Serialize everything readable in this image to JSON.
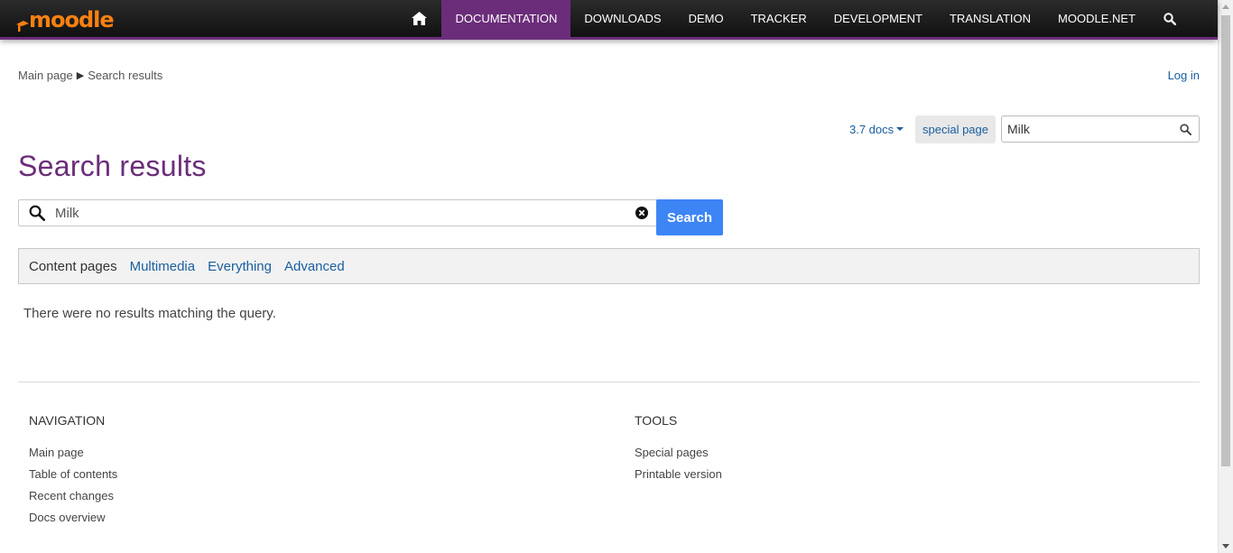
{
  "header": {
    "logo_text": "moodle",
    "nav": [
      "Documentation",
      "Downloads",
      "Demo",
      "Tracker",
      "Development",
      "Translation",
      "moodle.net"
    ],
    "active_index": 0,
    "home_icon": "home-icon",
    "search_icon": "search-icon",
    "accent_color": "#6b2d7a",
    "logo_color": "#f98012"
  },
  "breadcrumb": {
    "items": [
      "Main page",
      "Search results"
    ],
    "separator": "▶"
  },
  "login_label": "Log in",
  "tools": {
    "docs_version": "3.7 docs",
    "special_page": "special page",
    "search_value": "Milk"
  },
  "page_title": "Search results",
  "main_search": {
    "value": "Milk",
    "button_label": "Search",
    "button_color": "#3d85f5"
  },
  "filters": {
    "tabs": [
      "Content pages",
      "Multimedia",
      "Everything",
      "Advanced"
    ],
    "current_index": 0
  },
  "message": "There were no results matching the query.",
  "footer": {
    "navigation": {
      "title": "Navigation",
      "links": [
        "Main page",
        "Table of contents",
        "Recent changes",
        "Docs overview"
      ]
    },
    "tools": {
      "title": "Tools",
      "links": [
        "Special pages",
        "Printable version"
      ]
    }
  }
}
